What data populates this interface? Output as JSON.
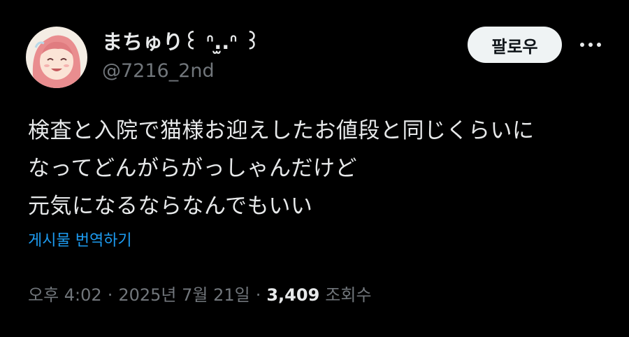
{
  "user": {
    "display_name": "まちゅり꒰ ᐢ.‎̫.ᐢ ꒱",
    "handle": "@7216_2nd"
  },
  "actions": {
    "follow_label": "팔로우",
    "more_icon": "more-horizontal-icon"
  },
  "tweet": {
    "lines": [
      "検査と入院で猫様お迎えしたお値段と同じくらいに",
      "なってどんがらがっしゃんだけど",
      "元気になるならなんでもいい"
    ],
    "translate_label": "게시물 번역하기"
  },
  "meta": {
    "time": "오후 4:02",
    "separator": "·",
    "date": "2025년 7월 21일",
    "views_count": "3,409",
    "views_label": "조회수"
  },
  "colors": {
    "background": "#000000",
    "text_primary": "#e7e9ea",
    "text_secondary": "#71767b",
    "link": "#1d9bf0",
    "follow_bg": "#eff3f4"
  }
}
